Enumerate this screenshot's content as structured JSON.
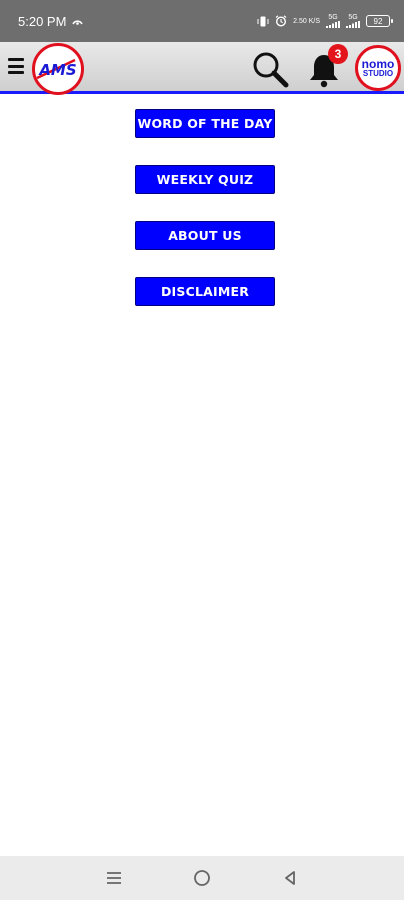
{
  "status_bar": {
    "time": "5:20 PM",
    "net_speed": "2.50 K/S",
    "signal_1": "5G",
    "signal_2": "5G",
    "battery": "92",
    "icons": [
      "data-saver-icon",
      "vibrate-icon",
      "alarm-icon",
      "signal-icon",
      "signal-icon",
      "battery-icon"
    ]
  },
  "app_bar": {
    "logo_text": "AMS",
    "notification_count": "3",
    "studio_logo_line1": "nomo",
    "studio_logo_line2": "STUDIO",
    "accent_color": "#1a1aff",
    "logo_border_color": "#e0101e",
    "icons": [
      "menu-icon",
      "search-icon",
      "bell-icon"
    ]
  },
  "menu": {
    "items": [
      {
        "label": "WORD OF THE DAY"
      },
      {
        "label": "WEEKLY QUIZ"
      },
      {
        "label": "ABOUT US"
      },
      {
        "label": "DISCLAIMER"
      }
    ],
    "button_color": "#0000ff"
  },
  "nav_bar": {
    "icons": [
      "recents-icon",
      "home-icon",
      "back-icon"
    ]
  }
}
